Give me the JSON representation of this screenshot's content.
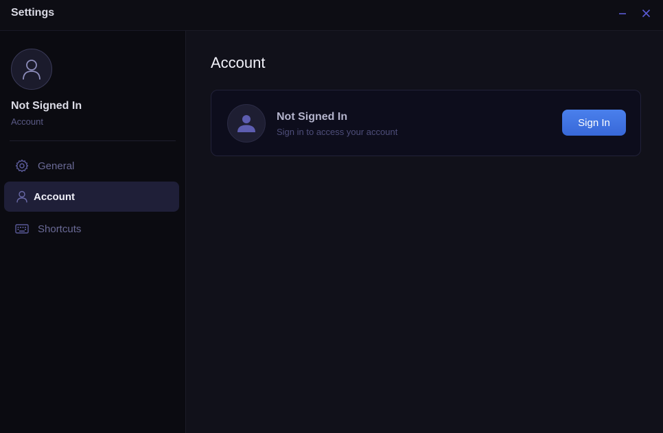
{
  "window": {
    "title": "Settings",
    "minimize_icon": "minimize-icon",
    "close_icon": "close-icon"
  },
  "sidebar": {
    "profile": {
      "name": "Not Signed In",
      "subtitle": "Account",
      "avatar_icon": "user-icon"
    },
    "items": [
      {
        "label": "General",
        "icon": "gear-icon",
        "active": false
      },
      {
        "label": "Account",
        "icon": "user-icon",
        "active": true
      },
      {
        "label": "Shortcuts",
        "icon": "keyboard-icon",
        "active": false
      }
    ]
  },
  "main": {
    "title": "Account",
    "card": {
      "title": "Not Signed In",
      "subtitle": "Sign in to access your account",
      "avatar_icon": "user-filled-icon",
      "button_label": "Sign In"
    }
  },
  "colors": {
    "accent": "#4a80ec",
    "icon_muted": "#5b5b9a",
    "active_bg": "#1f1f38"
  }
}
